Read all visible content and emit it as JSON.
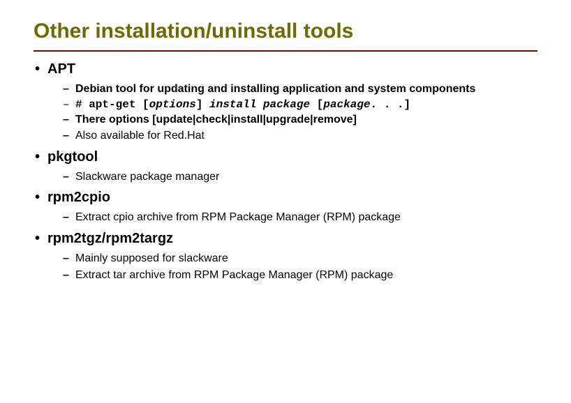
{
  "title": "Other installation/uninstall tools",
  "sections": [
    {
      "heading": "APT",
      "items": [
        {
          "type": "bold",
          "text": "Debian tool for updating and installing application and system components"
        },
        {
          "type": "code",
          "segments": [
            {
              "t": "# apt-get [",
              "s": "mono"
            },
            {
              "t": "options",
              "s": "mono-i"
            },
            {
              "t": "] ",
              "s": "mono"
            },
            {
              "t": "install package",
              "s": "mono-i"
            },
            {
              "t": " [",
              "s": "mono"
            },
            {
              "t": "package",
              "s": "mono-i"
            },
            {
              "t": ". . .]",
              "s": "mono"
            }
          ]
        },
        {
          "type": "bold",
          "text": "There options [update|check|install|upgrade|remove]"
        },
        {
          "type": "normal",
          "text": "Also available for Red.Hat"
        }
      ]
    },
    {
      "heading": "pkgtool",
      "items": [
        {
          "type": "normal",
          "text": "Slackware package manager"
        }
      ]
    },
    {
      "heading": "rpm2cpio",
      "items": [
        {
          "type": "normal",
          "text": "Extract cpio archive from RPM Package Manager (RPM) package"
        }
      ]
    },
    {
      "heading": "rpm2tgz/rpm2targz",
      "items": [
        {
          "type": "normal",
          "text": "Mainly supposed for slackware"
        },
        {
          "type": "normal",
          "text": "Extract tar archive from RPM Package Manager (RPM) package"
        }
      ]
    }
  ]
}
